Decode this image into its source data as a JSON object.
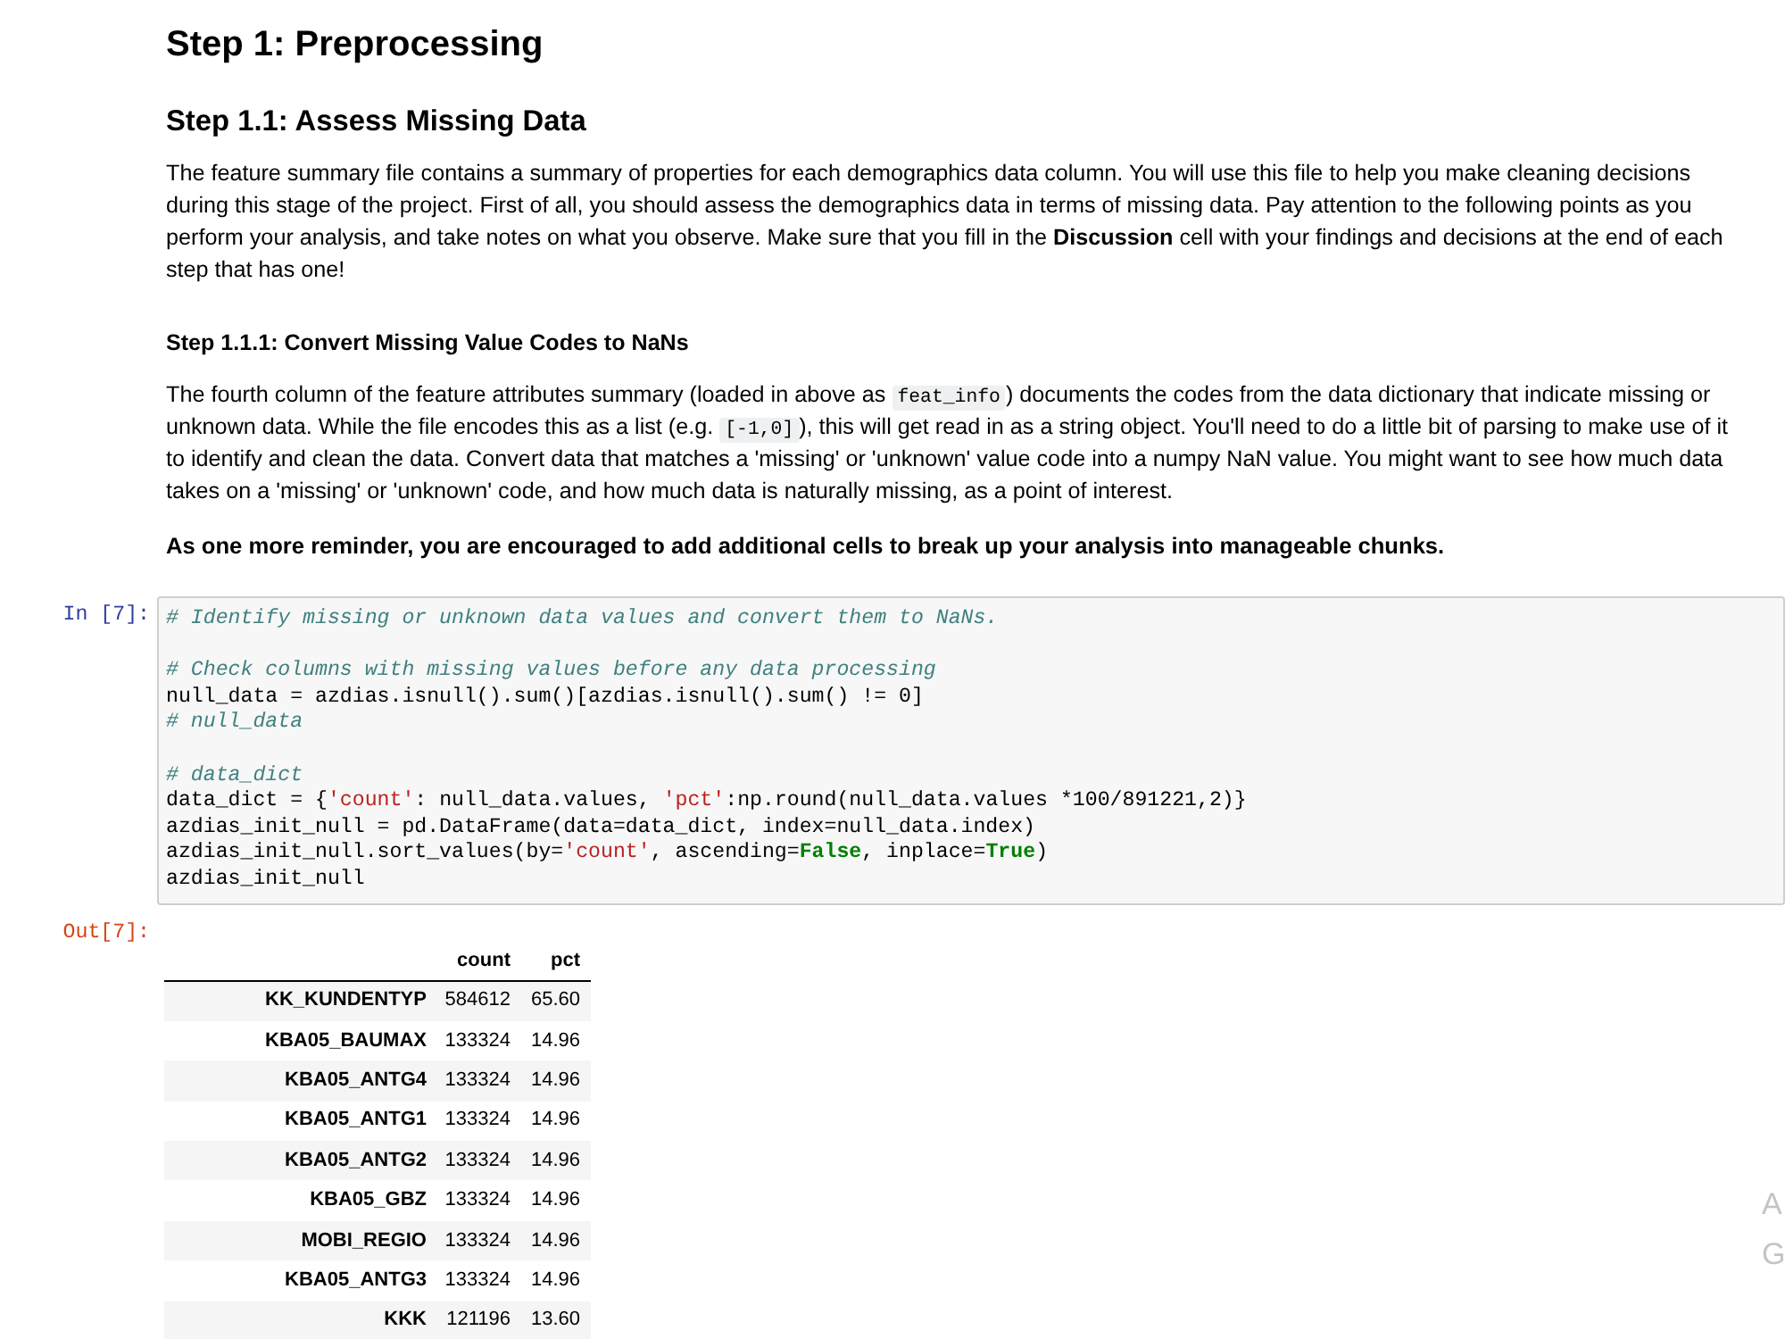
{
  "heading": "Step 1: Preprocessing",
  "section": {
    "title": "Step 1.1: Assess Missing Data",
    "paragraph": "The feature summary file contains a summary of properties for each demographics data column. You will use this file to help you make cleaning decisions during this stage of the project. First of all, you should assess the demographics data in terms of missing data. Pay attention to the following points as you perform your analysis, and take notes on what you observe. Make sure that you fill in the **Discussion** cell with your findings and decisions at the end of each step that has one!"
  },
  "subsection": {
    "title": "Step 1.1.1: Convert Missing Value Codes to NaNs",
    "paragraph": [
      {
        "kind": "text",
        "text": "The fourth column of the feature attributes summary (loaded in above as "
      },
      {
        "kind": "code",
        "text": "feat_info"
      },
      {
        "kind": "text",
        "text": ") documents the codes from the data dictionary that indicate missing or unknown data. While the file encodes this as a list (e.g. "
      },
      {
        "kind": "code",
        "text": "[-1,0]"
      },
      {
        "kind": "text",
        "text": "), this will get read in as a string object. You'll need to do a little bit of parsing to make use of it to identify and clean the data. Convert data that matches a 'missing' or 'unknown' value code into a numpy NaN value. You might want to see how much data takes on a 'missing' or 'unknown' code, and how much data is naturally missing, as a point of interest."
      }
    ],
    "reminder": "As one more reminder, you are encouraged to add additional cells to break up your analysis into manageable chunks."
  },
  "code_cell": {
    "prompt": "In [7]:",
    "blocks": [
      [
        [
          {
            "kind": "comment",
            "text": "# Identify missing or unknown data values and convert them to NaNs."
          }
        ]
      ],
      [
        [
          {
            "kind": "comment",
            "text": "# Check columns with missing values before any data processing"
          }
        ],
        [
          {
            "kind": "plain",
            "text": "null_data = azdias.isnull().sum()[azdias.isnull().sum() != 0]"
          }
        ],
        [
          {
            "kind": "comment",
            "text": "# null_data"
          }
        ]
      ],
      [
        [
          {
            "kind": "comment",
            "text": "# data_dict"
          }
        ],
        [
          {
            "kind": "plain",
            "text": "data_dict = {"
          },
          {
            "kind": "string",
            "text": "'count'"
          },
          {
            "kind": "plain",
            "text": ": null_data.values, "
          },
          {
            "kind": "string",
            "text": "'pct'"
          },
          {
            "kind": "plain",
            "text": ":np.round(null_data.values *100/891221,2)}"
          }
        ],
        [
          {
            "kind": "plain",
            "text": "azdias_init_null = pd.DataFrame(data=data_dict, index=null_data.index)"
          }
        ],
        [
          {
            "kind": "plain",
            "text": "azdias_init_null.sort_values(by="
          },
          {
            "kind": "string",
            "text": "'count'"
          },
          {
            "kind": "plain",
            "text": ", ascending="
          },
          {
            "kind": "keyword",
            "text": "False"
          },
          {
            "kind": "plain",
            "text": ", inplace="
          },
          {
            "kind": "keyword",
            "text": "True"
          },
          {
            "kind": "plain",
            "text": ")"
          }
        ],
        [
          {
            "kind": "plain",
            "text": "azdias_init_null"
          }
        ]
      ]
    ]
  },
  "output": {
    "prompt": "Out[7]:",
    "table": {
      "columns": [
        "count",
        "pct"
      ],
      "rows": [
        {
          "label": "KK_KUNDENTYP",
          "cells": [
            "584612",
            "65.60"
          ]
        },
        {
          "label": "KBA05_BAUMAX",
          "cells": [
            "133324",
            "14.96"
          ]
        },
        {
          "label": "KBA05_ANTG4",
          "cells": [
            "133324",
            "14.96"
          ]
        },
        {
          "label": "KBA05_ANTG1",
          "cells": [
            "133324",
            "14.96"
          ]
        },
        {
          "label": "KBA05_ANTG2",
          "cells": [
            "133324",
            "14.96"
          ]
        },
        {
          "label": "KBA05_GBZ",
          "cells": [
            "133324",
            "14.96"
          ]
        },
        {
          "label": "MOBI_REGIO",
          "cells": [
            "133324",
            "14.96"
          ]
        },
        {
          "label": "KBA05_ANTG3",
          "cells": [
            "133324",
            "14.96"
          ]
        },
        {
          "label": "KKK",
          "cells": [
            "121196",
            "13.60"
          ]
        }
      ]
    }
  },
  "overlay": {
    "lines": [
      "A",
      "G"
    ]
  }
}
